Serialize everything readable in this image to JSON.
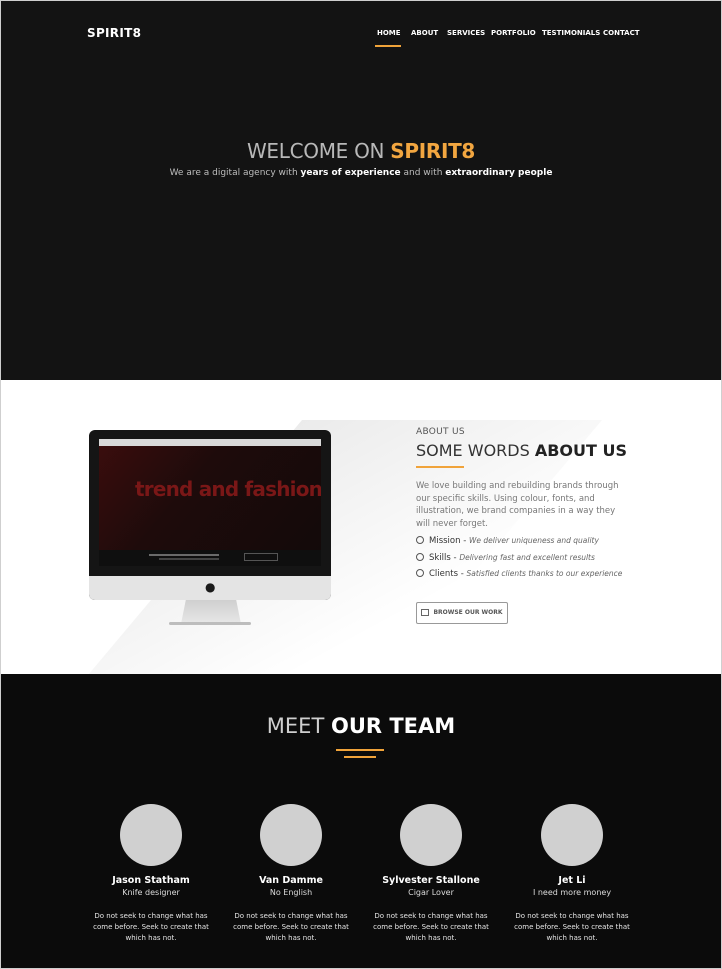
{
  "header": {
    "brand": "SPIRIT8",
    "nav": [
      "HOME",
      "ABOUT",
      "SERVICES",
      "PORTFOLIO",
      "TESTIMONIALS",
      "CONTACT"
    ],
    "active_nav": "HOME",
    "accent_color": "#f0a33a"
  },
  "hero": {
    "title_prefix": "WELCOME ON ",
    "title_accent": "SPIRIT8",
    "sub_1": "We are a digital agency with ",
    "sub_bold_1": "years of experience",
    "sub_2": " and with ",
    "sub_bold_2": "extraordinary people"
  },
  "about": {
    "monitor_screen_text": "trend and fashion",
    "kicker": "ABOUT US",
    "title_prefix": "SOME WORDS ",
    "title_bold": "ABOUT US",
    "body": "We love building and rebuilding brands through our specific skills. Using colour, fonts, and illustration, we brand companies in a way they will never forget.",
    "features": [
      {
        "name": "Mission",
        "desc": "We deliver uniqueness and quality"
      },
      {
        "name": "Skills",
        "desc": "Delivering fast and excellent results"
      },
      {
        "name": "Clients",
        "desc": "Satisfied clients thanks to our experience"
      }
    ],
    "button_label": "BROWSE OUR WORK"
  },
  "team": {
    "title_prefix": "MEET ",
    "title_bold": "OUR TEAM",
    "members": [
      {
        "name": "Jason Statham",
        "role": "Knife designer",
        "bio": "Do not seek to change what has come before. Seek to create that which has not."
      },
      {
        "name": "Van Damme",
        "role": "No English",
        "bio": "Do not seek to change what has come before. Seek to create that which has not."
      },
      {
        "name": "Sylvester Stallone",
        "role": "Cigar Lover",
        "bio": "Do not seek to change what has come before. Seek to create that which has not."
      },
      {
        "name": "Jet Li",
        "role": "I need more money",
        "bio": "Do not seek to change what has come before. Seek to create that which has not."
      }
    ]
  }
}
